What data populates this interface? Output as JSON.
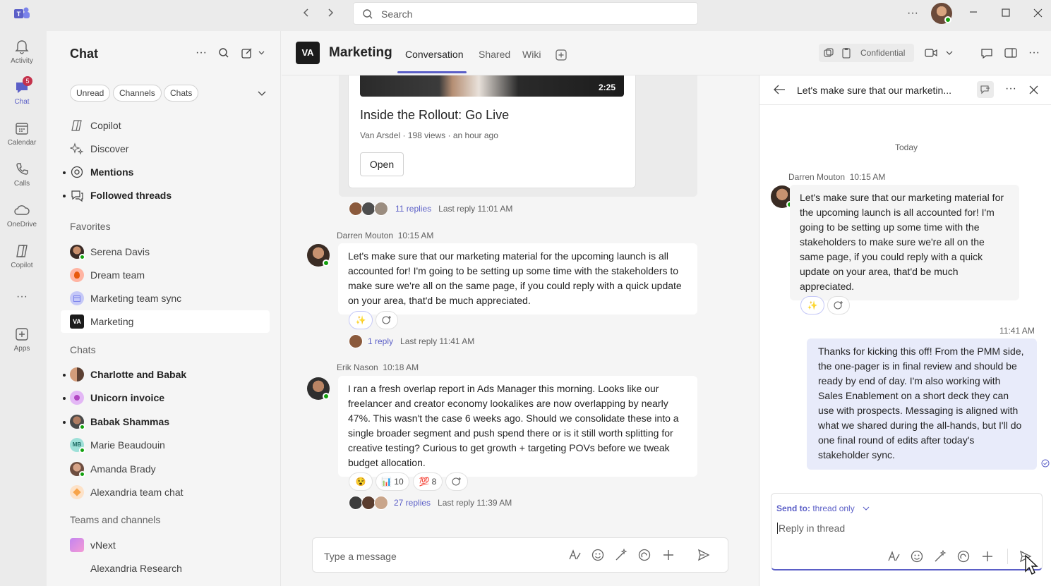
{
  "titlebar": {
    "search_placeholder": "Search",
    "more": "···"
  },
  "rail": {
    "items": [
      {
        "label": "Activity",
        "icon": "bell-icon"
      },
      {
        "label": "Chat",
        "icon": "chat-icon",
        "badge": "5"
      },
      {
        "label": "Calendar",
        "icon": "calendar-icon"
      },
      {
        "label": "Calls",
        "icon": "phone-icon"
      },
      {
        "label": "OneDrive",
        "icon": "cloud-icon"
      },
      {
        "label": "Copilot",
        "icon": "copilot-icon"
      },
      {
        "label": "···",
        "icon": "more-icon"
      },
      {
        "label": "Apps",
        "icon": "apps-icon"
      }
    ]
  },
  "chatpane": {
    "title": "Chat",
    "filters": [
      "Unread",
      "Channels",
      "Chats"
    ],
    "top_items": [
      {
        "label": "Copilot",
        "icon": "copilot-icon"
      },
      {
        "label": "Discover",
        "icon": "sparkle-icon"
      },
      {
        "label": "Mentions",
        "icon": "at-icon"
      },
      {
        "label": "Followed threads",
        "icon": "threads-icon"
      }
    ],
    "favorites_header": "Favorites",
    "favorites": [
      "Serena Davis",
      "Dream team",
      "Marketing team sync",
      "Marketing"
    ],
    "chats_header": "Chats",
    "chats": [
      "Charlotte and Babak",
      "Unicorn invoice",
      "Babak Shammas",
      "Marie Beaudouin",
      "Amanda Brady",
      "Alexandria team chat"
    ],
    "teams_header": "Teams and channels",
    "teams": [
      "vNext",
      "Alexandria Research"
    ],
    "avatar_initials": {
      "marie": "MB"
    }
  },
  "header": {
    "logo_text": "VA",
    "channel_name": "Marketing",
    "tabs": [
      "Conversation",
      "Shared",
      "Wiki"
    ],
    "sensitivity": "Confidential"
  },
  "video_card": {
    "duration": "2:25",
    "title": "Inside the Rollout: Go Live",
    "meta": "Van Arsdel · 198 views · an hour ago",
    "button": "Open",
    "replies": "11 replies",
    "last_reply": "Last reply 11:01 AM"
  },
  "messages": [
    {
      "author": "Darren Mouton",
      "time": "10:15 AM",
      "text": "Let's make sure that our marketing material for the upcoming launch is all accounted for! I'm going to be setting up some time with the stakeholders to make sure we're all on the same page, if you could reply with a quick update on your area, that'd be much appreciated.",
      "replies": "1 reply",
      "last_reply": "Last reply 11:41 AM"
    },
    {
      "author": "Erik Nason",
      "time": "10:18 AM",
      "text": "I ran a fresh overlap report in Ads Manager this morning. Looks like our freelancer and creator economy lookalikes are now overlapping by nearly 47%. This wasn't the case 6 weeks ago. Should we consolidate these into a single broader segment and push spend there or is it still worth splitting for creative testing? Curious to get growth + targeting POVs before we tweak budget allocation.",
      "reactions": [
        {
          "emoji": "😵",
          "count": ""
        },
        {
          "emoji": "📊",
          "count": "10"
        },
        {
          "emoji": "💯",
          "count": "8"
        }
      ],
      "replies": "27 replies",
      "last_reply": "Last reply 11:39 AM"
    }
  ],
  "compose": {
    "placeholder": "Type a message"
  },
  "thread": {
    "title": "Let's make sure that our marketin...",
    "day": "Today",
    "author": "Darren Mouton",
    "time": "10:15 AM",
    "root_text": "Let's make sure that our marketing material for the upcoming launch is all accounted for! I'm going to be setting up some time with the stakeholders to make sure we're all on the same page, if you could reply with a quick update on your area, that'd be much appreciated.",
    "reply_time": "11:41 AM",
    "reply_text": "Thanks for kicking this off! From the PMM side, the one-pager is in final review and should be ready by end of day. I'm also working with Sales Enablement on a short deck they can use with prospects. Messaging is aligned with what we shared during the all-hands, but I'll do one final round of edits after today's stakeholder sync.",
    "send_to_label": "Send to:",
    "send_to_value": "thread only",
    "reply_placeholder": "Reply in thread"
  },
  "colors": {
    "brand": "#5b5fc7",
    "presence": "#13a10e",
    "badge": "#c4314b"
  }
}
